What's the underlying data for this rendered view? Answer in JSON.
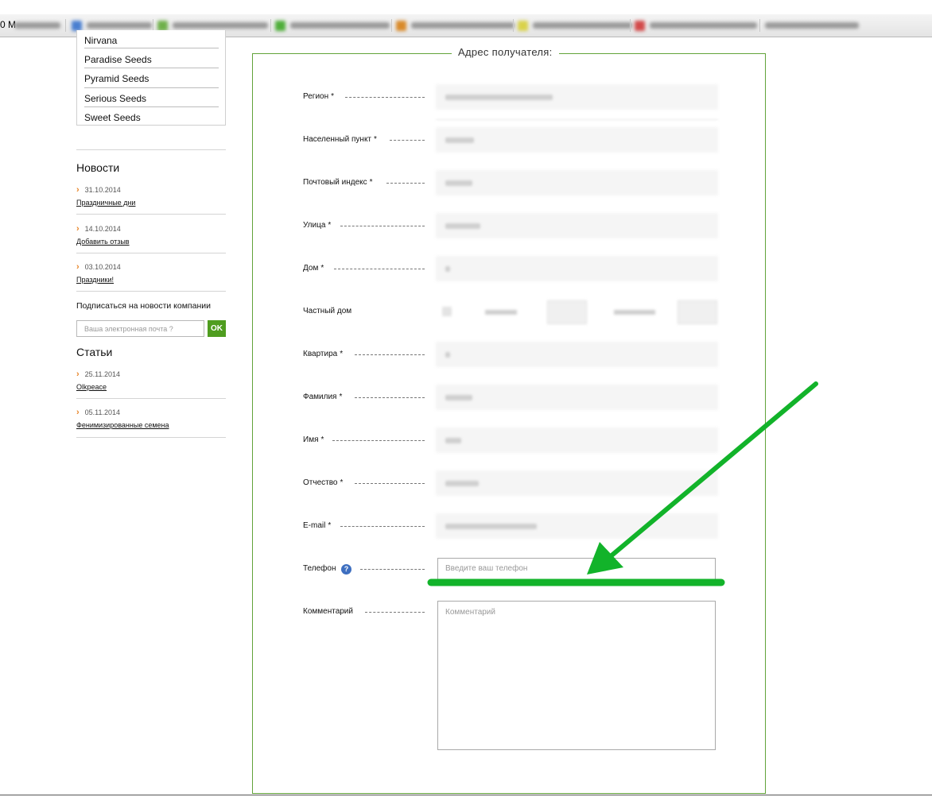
{
  "browser": {
    "bookmark_prefix": "0 M"
  },
  "sidebar": {
    "brands": [
      "Nirvana",
      "Paradise Seeds",
      "Pyramid Seeds",
      "Serious Seeds",
      "Sweet Seeds"
    ],
    "news": {
      "title": "Новости",
      "items": [
        {
          "date": "31.10.2014",
          "link": "Праздничные дни"
        },
        {
          "date": "14.10.2014",
          "link": "Добавить отзыв"
        },
        {
          "date": "03.10.2014",
          "link": "Праздники!"
        }
      ]
    },
    "subscribe": {
      "label": "Подписаться на новости компании",
      "placeholder": "Ваша электронная почта ?",
      "button": "OK"
    },
    "articles": {
      "title": "Статьи",
      "items": [
        {
          "date": "25.11.2014",
          "link": "Olkpeace"
        },
        {
          "date": "05.11.2014",
          "link": "Фенимизированные семена"
        }
      ]
    }
  },
  "form": {
    "legend": "Адрес получателя:",
    "fields": {
      "region": {
        "label": "Регион",
        "star": "*"
      },
      "city": {
        "label": "Населенный пункт",
        "star": "*"
      },
      "postcode": {
        "label": "Почтовый индекс",
        "star": "*"
      },
      "street": {
        "label": "Улица",
        "star": "*"
      },
      "house": {
        "label": "Дом",
        "star": "*"
      },
      "private_house": {
        "label": "Частный дом"
      },
      "apartment": {
        "label": "Квартира",
        "star": "*"
      },
      "surname": {
        "label": "Фамилия",
        "star": "*"
      },
      "name": {
        "label": "Имя",
        "star": "*"
      },
      "patronymic": {
        "label": "Отчество",
        "star": "*"
      },
      "email": {
        "label": "E-mail",
        "star": "*"
      },
      "phone": {
        "label": "Телефон",
        "help": "?",
        "placeholder": "Введите ваш телефон"
      },
      "comment": {
        "label": "Комментарий",
        "placeholder": "Комментарий"
      }
    }
  },
  "colors": {
    "accent_green": "#4f9d1f",
    "fieldset_border": "#62a33a",
    "annotation_green": "#12b32a",
    "date_chevron": "#e8862a"
  }
}
